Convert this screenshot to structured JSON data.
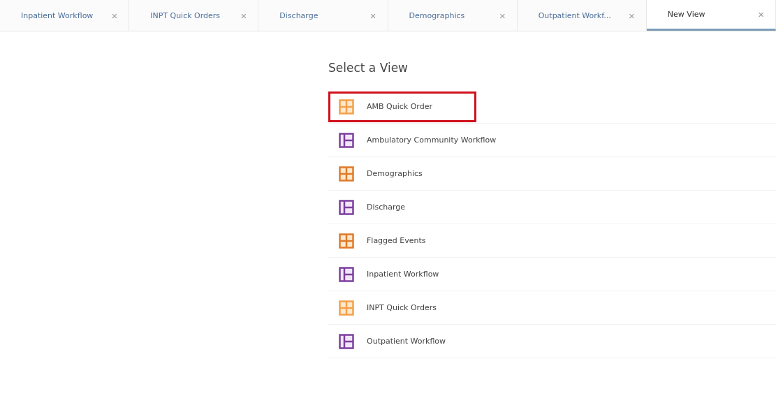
{
  "tabs": [
    {
      "label": "Inpatient Workflow",
      "close": "×",
      "selected": false
    },
    {
      "label": "INPT Quick Orders",
      "close": "×",
      "selected": false
    },
    {
      "label": "Discharge",
      "close": "×",
      "selected": false
    },
    {
      "label": "Demographics",
      "close": "×",
      "selected": false
    },
    {
      "label": "Outpatient Workf...",
      "close": "×",
      "selected": false
    },
    {
      "label": "New View",
      "close": "×",
      "selected": true
    }
  ],
  "heading": "Select a View",
  "views": [
    {
      "label": "AMB Quick Order",
      "kind": "grid",
      "color": "#f4a04a",
      "highlighted": true
    },
    {
      "label": "Ambulatory Community Workflow",
      "kind": "sidebar",
      "color": "#7b3f9e",
      "highlighted": false
    },
    {
      "label": "Demographics",
      "kind": "grid",
      "color": "#e07a2a",
      "highlighted": false
    },
    {
      "label": "Discharge",
      "kind": "sidebar",
      "color": "#7b3f9e",
      "highlighted": false
    },
    {
      "label": "Flagged Events",
      "kind": "grid",
      "color": "#e07a2a",
      "highlighted": false
    },
    {
      "label": "Inpatient Workflow",
      "kind": "sidebar",
      "color": "#7b3f9e",
      "highlighted": false
    },
    {
      "label": "INPT Quick Orders",
      "kind": "grid",
      "color": "#f4a04a",
      "highlighted": false
    },
    {
      "label": "Outpatient Workflow",
      "kind": "sidebar",
      "color": "#7b3f9e",
      "highlighted": false
    }
  ]
}
